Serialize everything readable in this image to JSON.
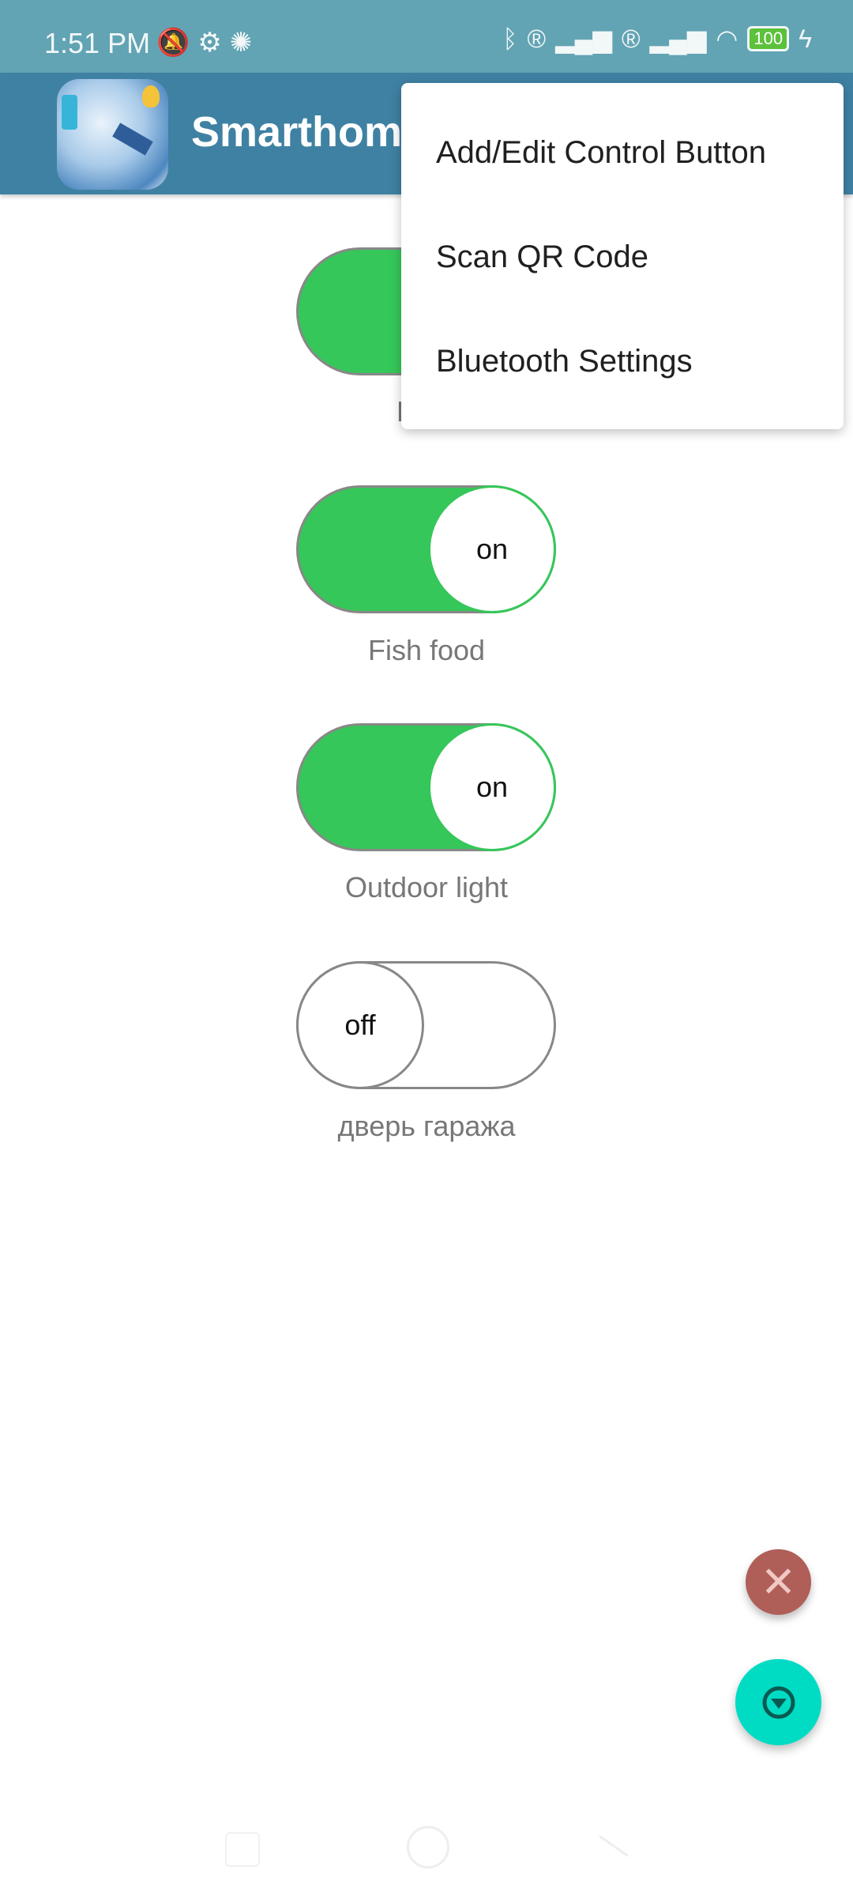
{
  "status_bar": {
    "time": "1:51 PM",
    "left_icons": [
      "notifications-muted-icon",
      "android-debug-icon",
      "settings-icon"
    ],
    "right_icons": [
      "bluetooth-icon",
      "roaming-icon",
      "signal-icon",
      "roaming-icon",
      "signal-icon",
      "wifi-icon",
      "charging-icon"
    ],
    "battery": "100",
    "battery_color": "#5cc13b"
  },
  "app_bar": {
    "title": "Smarthom",
    "color": "#3f81a3"
  },
  "toggles": [
    {
      "label": "Hom",
      "state": "on"
    },
    {
      "label": "Fish food",
      "state": "on",
      "knob_text": "on"
    },
    {
      "label": "Outdoor light",
      "state": "on",
      "knob_text": "on"
    },
    {
      "label": "дверь гаража",
      "state": "off",
      "knob_text": "off"
    }
  ],
  "menu": {
    "items": [
      "Add/Edit Control Button",
      "Scan QR Code",
      "Bluetooth Settings"
    ]
  },
  "fabs": {
    "close_icon": "close-icon",
    "close_color": "#b05e58",
    "main_icon": "arrow-down-circle-icon",
    "main_color": "#00dcc4"
  },
  "colors": {
    "toggle_on": "#35c759",
    "status_bar": "#62a4b4"
  }
}
